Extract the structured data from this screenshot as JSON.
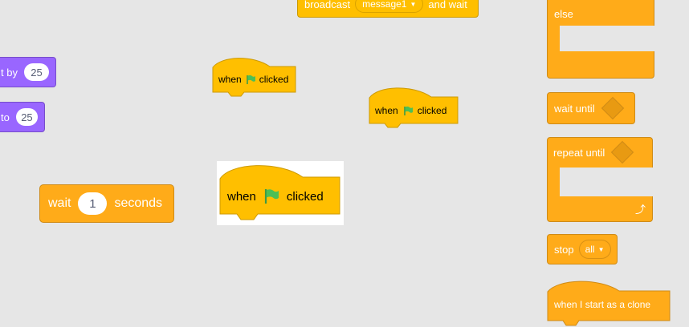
{
  "colors": {
    "canvas": "#e6e6e6",
    "control": "#ffab19",
    "events": "#ffbf00",
    "motion": "#9966ff",
    "flag": "#4cbf56"
  },
  "motion": {
    "change_by": {
      "label": "t by",
      "value": "25"
    },
    "set_to": {
      "label": "to",
      "value": "25"
    }
  },
  "events": {
    "broadcast": {
      "label": "broadcast",
      "message": "message1",
      "suffix": "and wait"
    },
    "hat1": {
      "when": "when",
      "clicked": "clicked",
      "icon": "green-flag-icon"
    },
    "hat2": {
      "when": "when",
      "clicked": "clicked",
      "icon": "green-flag-icon"
    },
    "hat_selected": {
      "when": "when",
      "clicked": "clicked",
      "icon": "green-flag-icon"
    }
  },
  "control": {
    "wait": {
      "label": "wait",
      "value": "1",
      "unit": "seconds"
    },
    "else": {
      "label": "else"
    },
    "wait_until": {
      "label": "wait until"
    },
    "repeat_until": {
      "label": "repeat until",
      "icon": "loop-arrow-icon"
    },
    "stop": {
      "label": "stop",
      "option": "all"
    },
    "clone": {
      "label": "when I start as a clone"
    }
  }
}
